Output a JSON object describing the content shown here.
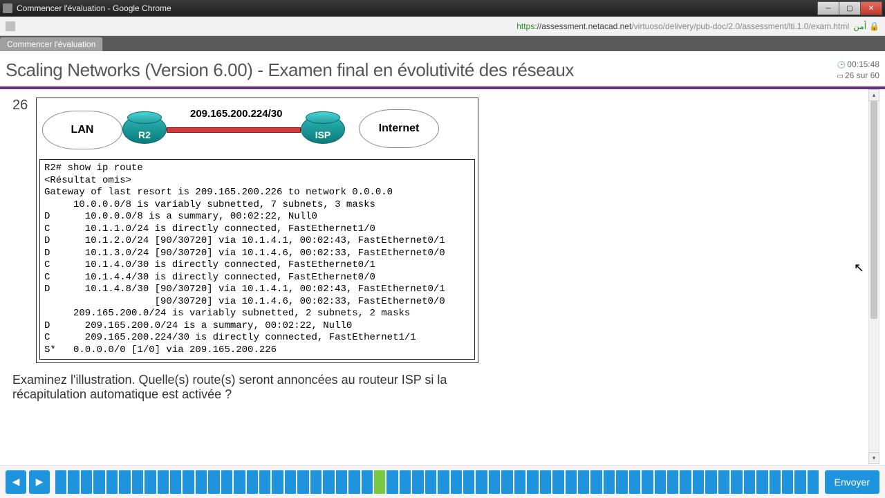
{
  "window": {
    "title": "Commencer l'évaluation - Google Chrome"
  },
  "address": {
    "url_prefix": "https",
    "url_host": "://assessment.netacad.net",
    "url_path": "/virtuoso/delivery/pub-doc/2.0/assessment/lti.1.0/exam.html",
    "secure_label": "أمن"
  },
  "tab": {
    "label": "Commencer l'évaluation"
  },
  "exam": {
    "title": "Scaling Networks (Version 6.00) - Examen final en évolutivité des réseaux",
    "timer": "00:15:48",
    "progress": "26 sur 60"
  },
  "question": {
    "number": "26",
    "diagram": {
      "left_cloud": "LAN",
      "r2_label": "R2",
      "subnet": "209.165.200.224/30",
      "isp_label": "ISP",
      "right_cloud": "Internet"
    },
    "cli": "R2# show ip route\n<Résultat omis>\nGateway of last resort is 209.165.200.226 to network 0.0.0.0\n     10.0.0.0/8 is variably subnetted, 7 subnets, 3 masks\nD      10.0.0.0/8 is a summary, 00:02:22, Null0\nC      10.1.1.0/24 is directly connected, FastEthernet1/0\nD      10.1.2.0/24 [90/30720] via 10.1.4.1, 00:02:43, FastEthernet0/1\nD      10.1.3.0/24 [90/30720] via 10.1.4.6, 00:02:33, FastEthernet0/0\nC      10.1.4.0/30 is directly connected, FastEthernet0/1\nC      10.1.4.4/30 is directly connected, FastEthernet0/0\nD      10.1.4.8/30 [90/30720] via 10.1.4.1, 00:02:43, FastEthernet0/1\n                   [90/30720] via 10.1.4.6, 00:02:33, FastEthernet0/0\n     209.165.200.0/24 is variably subnetted, 2 subnets, 2 masks\nD      209.165.200.0/24 is a summary, 00:02:22, Null0\nC      209.165.200.224/30 is directly connected, FastEthernet1/1\nS*   0.0.0.0/0 [1/0] via 209.165.200.226",
    "text": "Examinez l'illustration. Quelle(s) route(s) seront annoncées au routeur ISP si la récapitulation automatique est activée ?"
  },
  "nav": {
    "total": 60,
    "current": 26,
    "submit": "Envoyer"
  }
}
